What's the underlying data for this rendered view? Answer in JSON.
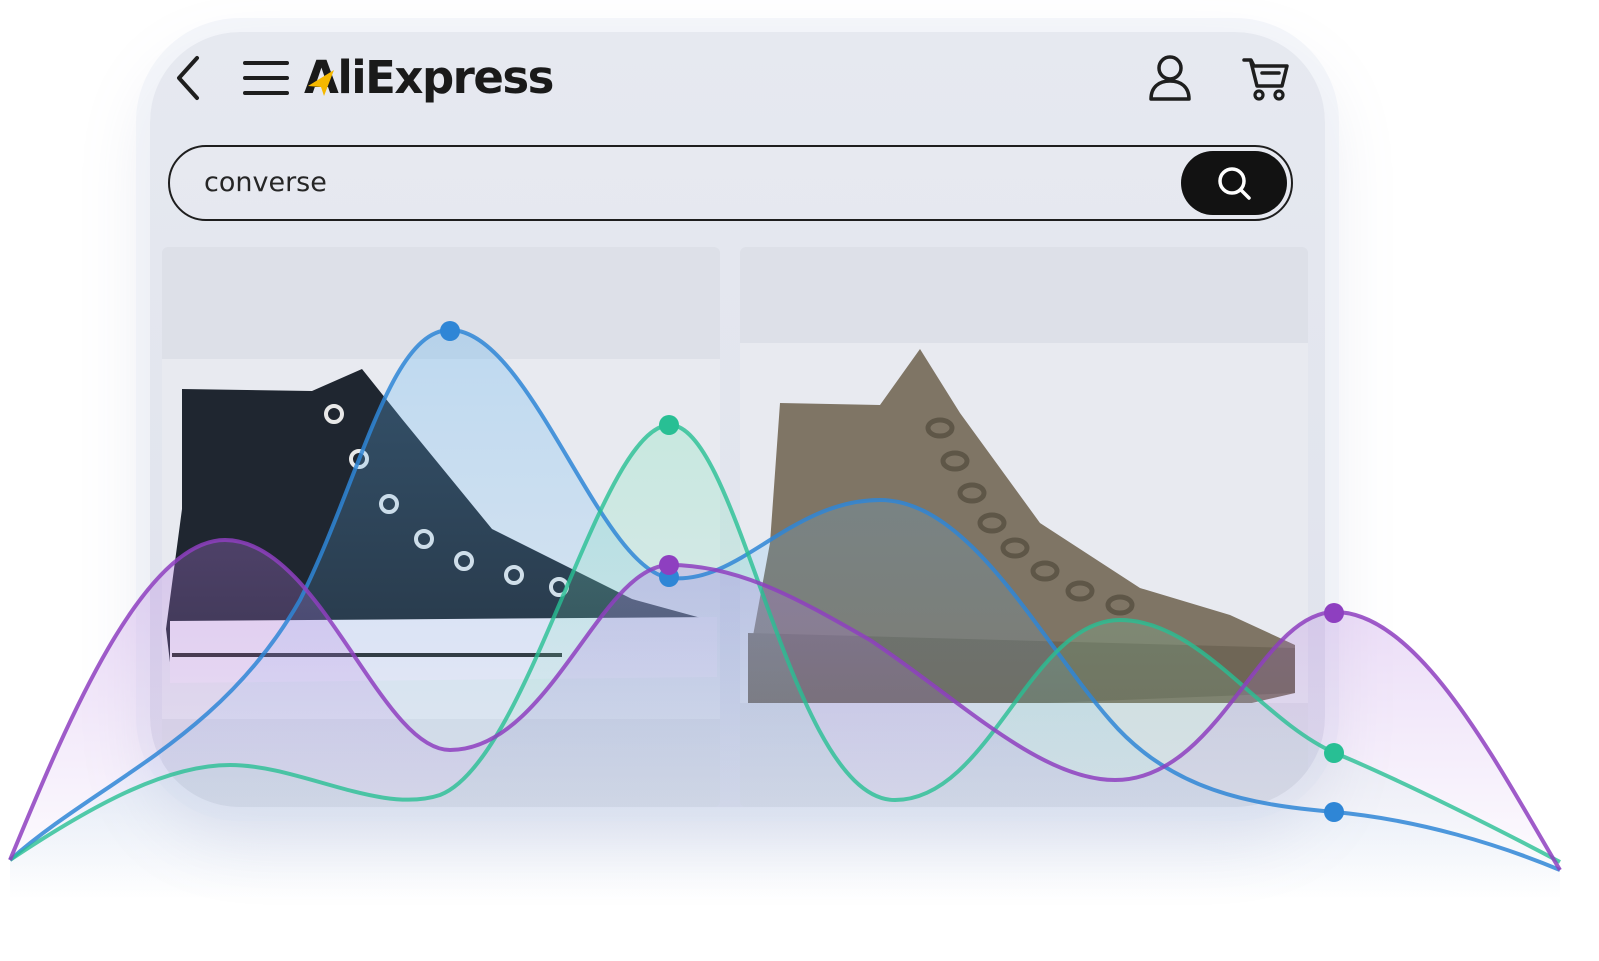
{
  "app": {
    "brand_name": "AliExpress",
    "brand_color": "#1a1a1a",
    "accent_color": "#f5b800"
  },
  "header": {
    "back_icon": "chevron-left-icon",
    "menu_icon": "hamburger-menu-icon",
    "account_icon": "user-icon",
    "cart_icon": "shopping-cart-icon"
  },
  "search": {
    "value": "converse",
    "button_icon": "search-icon"
  },
  "products": [
    {
      "image": "black-high-top-sneaker",
      "color": "#1f2630"
    },
    {
      "image": "taupe-high-top-sneaker",
      "color": "#7f7565"
    }
  ],
  "decorative_lines": [
    {
      "name": "blue",
      "color": "#2f86d6"
    },
    {
      "name": "green",
      "color": "#28bf94"
    },
    {
      "name": "purple",
      "color": "#8e3fc0"
    }
  ]
}
